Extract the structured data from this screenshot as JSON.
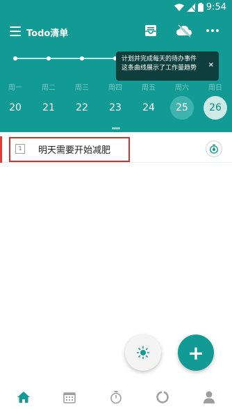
{
  "status_bar": {
    "time": "9:54"
  },
  "app_bar": {
    "title": "Todo清单",
    "icons": [
      "menu-icon",
      "inbox-icon",
      "cloud-off-icon",
      "more-icon"
    ]
  },
  "tooltip": {
    "line1": "计划并完成每天的待办事件",
    "line2": "这条曲线展示了工作量趋势",
    "close": "×"
  },
  "week": {
    "days": [
      "周一",
      "周二",
      "周三",
      "周四",
      "周五",
      "周六",
      "周日"
    ],
    "dates": [
      "20",
      "21",
      "22",
      "23",
      "24",
      "25",
      "26"
    ],
    "selected_date": "26"
  },
  "tasks": [
    {
      "index": "1",
      "text": "明天需要开始减肥",
      "icon": "timer-icon"
    }
  ],
  "fabs": {
    "add": "+",
    "theme_icon": "sun-icon"
  },
  "bottom_nav": [
    "home-icon",
    "calendar-icon",
    "timer-icon",
    "stats-icon",
    "profile-icon"
  ],
  "colors": {
    "primary": "#129a94",
    "accent_red": "#e53935"
  }
}
